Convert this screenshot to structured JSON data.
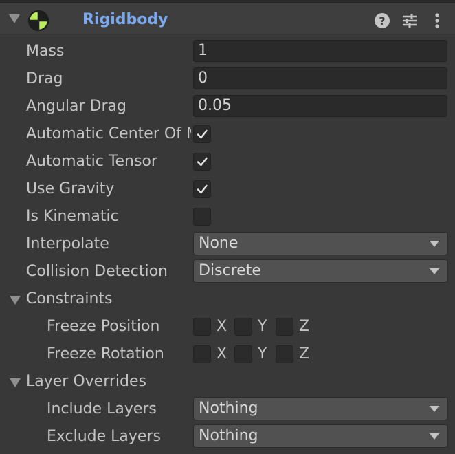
{
  "component": {
    "title": "Rigidbody"
  },
  "properties": {
    "mass": {
      "label": "Mass",
      "value": "1"
    },
    "drag": {
      "label": "Drag",
      "value": "0"
    },
    "angular_drag": {
      "label": "Angular Drag",
      "value": "0.05"
    },
    "automatic_center_of_mass": {
      "label": "Automatic Center Of Mass",
      "checked": true
    },
    "automatic_tensor": {
      "label": "Automatic Tensor",
      "checked": true
    },
    "use_gravity": {
      "label": "Use Gravity",
      "checked": true
    },
    "is_kinematic": {
      "label": "Is Kinematic",
      "checked": false
    },
    "interpolate": {
      "label": "Interpolate",
      "value": "None"
    },
    "collision_detection": {
      "label": "Collision Detection",
      "value": "Discrete"
    }
  },
  "constraints": {
    "label": "Constraints",
    "freeze_position": {
      "label": "Freeze Position",
      "x": "X",
      "y": "Y",
      "z": "Z"
    },
    "freeze_rotation": {
      "label": "Freeze Rotation",
      "x": "X",
      "y": "Y",
      "z": "Z"
    }
  },
  "layer_overrides": {
    "label": "Layer Overrides",
    "include_layers": {
      "label": "Include Layers",
      "value": "Nothing"
    },
    "exclude_layers": {
      "label": "Exclude Layers",
      "value": "Nothing"
    }
  },
  "icons": {
    "component": "rigidbody-icon",
    "help": "help-icon",
    "presets": "presets-icon",
    "menu": "more-menu-icon"
  },
  "colors": {
    "title": "#7ba9ef",
    "icon_green": "#b9ec58",
    "background": "#383838"
  }
}
